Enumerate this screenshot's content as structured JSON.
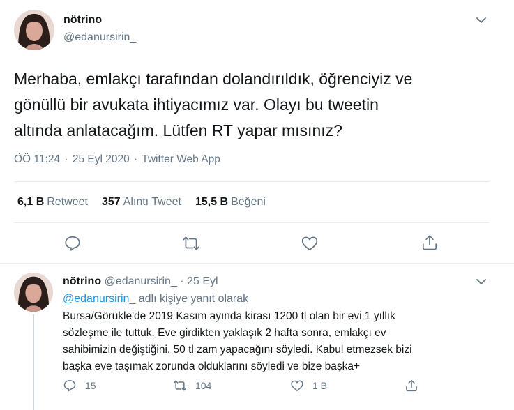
{
  "main_tweet": {
    "display_name": "nötrino",
    "handle": "@edanursirin_",
    "text": "Merhaba, emlakçı tarafından dolandırıldık, öğrenciyiz ve\ngönüllü bir avukata ihtiyacımız var. Olayı bu tweetin\naltında anlatacağım. Lütfen RT yapar mısınız?",
    "time": "ÖÖ 11:24",
    "date": "25 Eyl 2020",
    "source": "Twitter Web App",
    "separator": "·",
    "stats": {
      "retweets_count": "6,1 B",
      "retweets_label": "Retweet",
      "quotes_count": "357",
      "quotes_label": "Alıntı Tweet",
      "likes_count": "15,5 B",
      "likes_label": "Beğeni"
    }
  },
  "reply_tweet": {
    "display_name": "nötrino",
    "handle": "@edanursirin_",
    "dot": "·",
    "date": "25 Eyl",
    "replying_mention": "@edanursirin_",
    "replying_suffix": " adlı kişiye yanıt olarak",
    "text": "Bursa/Görükle'de 2019 Kasım ayında kirası 1200 tl olan bir evi 1 yıllık\nsözleşme ile tuttuk. Eve girdikten yaklaşık 2 hafta sonra, emlakçı ev\nsahibimizin değiştiğini, 50 tl zam yapacağını söyledi. Kabul etmezsek bizi\nbaşka eve taşımak zorunda olduklarını söyledi ve bize başka+",
    "reply_count": "15",
    "retweet_count": "104",
    "like_count": "1 B"
  },
  "icons": {
    "reply": "reply-icon",
    "retweet": "retweet-icon",
    "like": "heart-icon",
    "share": "share-icon",
    "more": "chevron-down-icon"
  },
  "colors": {
    "text": "#14171a",
    "secondary": "#657786",
    "link": "#1b95e0",
    "divider": "#e6ecf0"
  }
}
